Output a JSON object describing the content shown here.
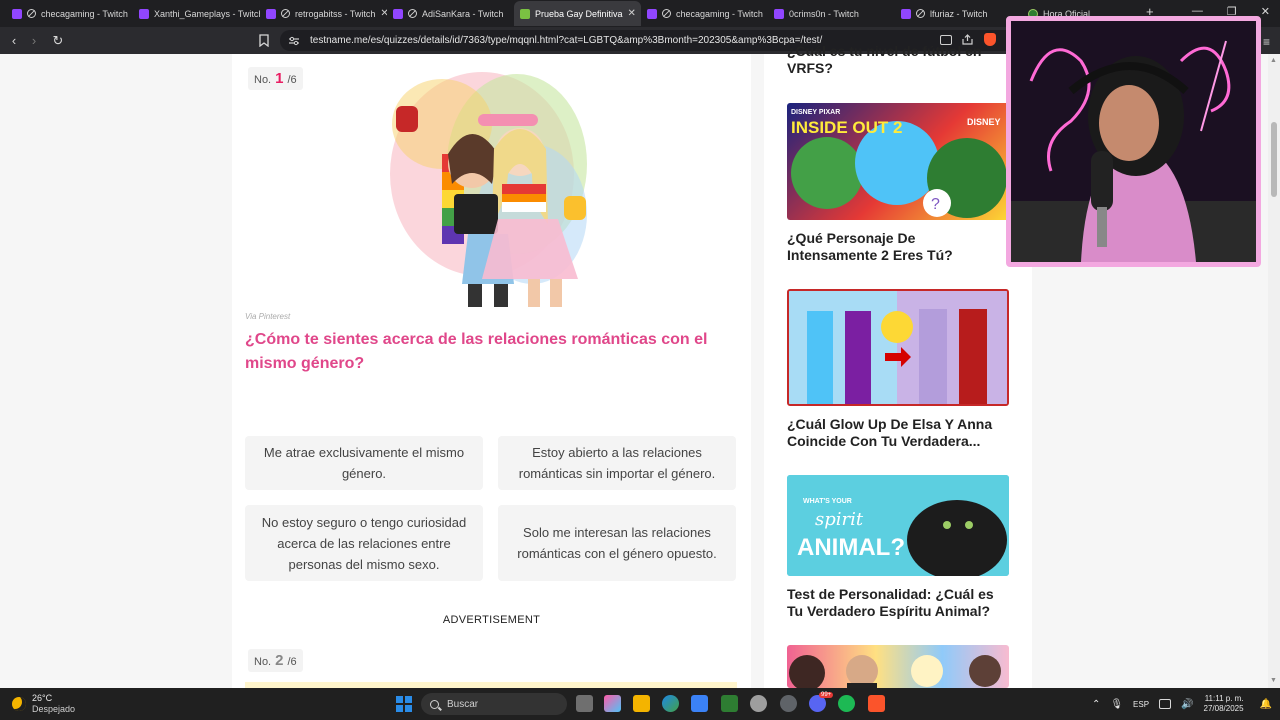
{
  "browser": {
    "tabs": [
      {
        "label": "checagaming - Twitch",
        "muted": true
      },
      {
        "label": "Xanthi_Gameplays - Twitch",
        "muted": false
      },
      {
        "label": "retrogabitss - Twitch",
        "muted": true
      },
      {
        "label": "AdiSanKara - Twitch",
        "muted": true
      },
      {
        "label": "Prueba Gay Definitiva",
        "active": true
      },
      {
        "label": "checagaming - Twitch",
        "muted": true
      },
      {
        "label": "0crims0n - Twitch",
        "muted": false
      },
      {
        "label": "lfuriaz - Twitch",
        "muted": true
      },
      {
        "label": "Hora Oficial",
        "muted": false
      }
    ],
    "close_glyph": "✕",
    "new_tab_glyph": "+",
    "window_controls": [
      "—",
      "❐",
      "✕"
    ],
    "url": "testname.me/es/quizzes/details/id/7363/type/mqqnl.html?cat=LGBTQ&amp%3Bmonth=202305&amp%3Bcpa=/test/",
    "nav": {
      "back": "‹",
      "forward": "›",
      "reload": "↻",
      "menu": "≡"
    }
  },
  "quiz": {
    "q1": {
      "prefix": "No.",
      "number": "1",
      "total": "/6",
      "credit": "Via Pinterest",
      "question": "¿Cómo te sientes acerca de las relaciones románticas con el mismo género?",
      "answers": [
        "Me atrae exclusivamente el mismo género.",
        "Estoy abierto a las relaciones románticas sin importar el género.",
        "No estoy seguro o tengo curiosidad acerca de las relaciones entre personas del mismo sexo.",
        "Solo me interesan las relaciones románticas con el género opuesto."
      ]
    },
    "ad_label": "ADVERTISEMENT",
    "q2": {
      "prefix": "No.",
      "number": "2",
      "total": "/6"
    }
  },
  "sidebar": {
    "partial_title": "¿Cuál es tu nivel de fútbol en VRFS?",
    "cards": [
      {
        "title": "¿Qué Personaje De Intensamente 2 Eres Tú?",
        "thumb_text": [
          "DISNEY PIXAR",
          "INSIDE OUT 2",
          "DISNEY"
        ]
      },
      {
        "title": "¿Cuál Glow Up De Elsa Y Anna Coincide Con Tu Verdadera...",
        "thumb_text": []
      },
      {
        "title": "Test de Personalidad: ¿Cuál es Tu Verdadero Espíritu Animal?",
        "thumb_text": [
          "WHAT'S YOUR",
          "spirit",
          "ANIMAL?"
        ]
      }
    ]
  },
  "taskbar": {
    "temperature": "26°C",
    "weather": "Despejado",
    "search_placeholder": "Buscar",
    "language": "ESP",
    "time": "11:11 p. m.",
    "date": "27/08/2025",
    "discord_badge": "99+"
  },
  "colors": {
    "accent_pink": "#e0478a",
    "number_pink": "#e91e63",
    "twitch_purple": "#9146ff",
    "cam_border": "#f3a8e0"
  }
}
